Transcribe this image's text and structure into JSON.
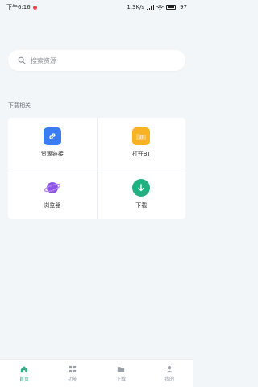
{
  "status_bar": {
    "time": "下午6:16",
    "net_speed": "1.3K/s",
    "battery": "97"
  },
  "search": {
    "placeholder": "搜索资源",
    "icon": "search-icon"
  },
  "section": {
    "title": "下载相关"
  },
  "tiles": [
    {
      "label": "资源链接",
      "icon": "link-icon",
      "color": "#3b7cf3"
    },
    {
      "label": "打开BT",
      "icon": "folder-icon",
      "color": "#f7b325"
    },
    {
      "label": "浏览器",
      "icon": "planet-icon",
      "color": "#8c55e6"
    },
    {
      "label": "下载",
      "icon": "download-icon",
      "color": "#21b07f"
    }
  ],
  "bottom_nav": [
    {
      "label": "首页",
      "icon": "home-icon",
      "active": true
    },
    {
      "label": "功能",
      "icon": "grid-icon",
      "active": false
    },
    {
      "label": "下载",
      "icon": "folder-icon",
      "active": false
    },
    {
      "label": "我的",
      "icon": "user-icon",
      "active": false
    }
  ],
  "colors": {
    "accent": "#2fb08a",
    "background": "#f3f6f8"
  }
}
